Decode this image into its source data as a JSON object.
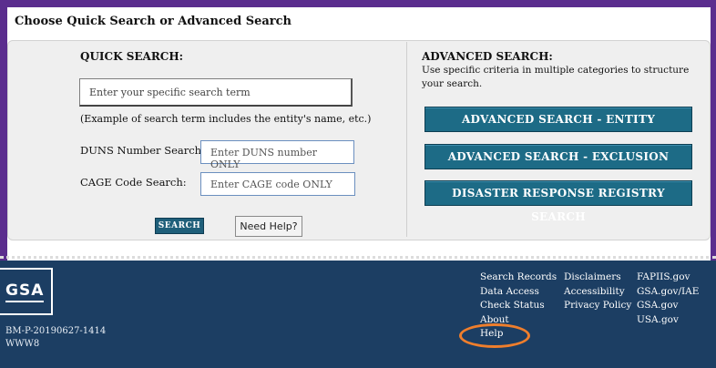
{
  "page": {
    "title": "Choose Quick Search or Advanced Search"
  },
  "quick_search": {
    "heading": "QUICK SEARCH:",
    "search_placeholder": "Enter your specific search term",
    "example_text": "(Example of search term includes the entity's name, etc.)",
    "duns_label": "DUNS Number Search:",
    "duns_placeholder": "Enter DUNS number ONLY",
    "cage_label": "CAGE Code Search:",
    "cage_placeholder": "Enter CAGE code ONLY",
    "search_button": "SEARCH",
    "help_button": "Need Help?"
  },
  "advanced_search": {
    "heading": "ADVANCED SEARCH:",
    "description": "Use specific criteria in multiple categories to structure your search.",
    "buttons": [
      "ADVANCED SEARCH - ENTITY",
      "ADVANCED SEARCH - EXCLUSION",
      "DISASTER RESPONSE REGISTRY SEARCH"
    ]
  },
  "footer": {
    "logo_text": "GSA",
    "id_lines": [
      "BM-P-20190627-1414",
      "WWW8"
    ],
    "links_col1": [
      "Search Records",
      "Data Access",
      "Check Status",
      "About",
      "Help"
    ],
    "links_col2": [
      "Disclaimers",
      "Accessibility",
      "Privacy Policy"
    ],
    "links_col3": [
      "FAPIIS.gov",
      "GSA.gov/IAE",
      "GSA.gov",
      "USA.gov"
    ],
    "highlight_color": "#ef7e2c"
  },
  "colors": {
    "frame": "#5b2d8e",
    "footer_bg": "#1c3e63",
    "button_bg": "#1d6b86"
  }
}
